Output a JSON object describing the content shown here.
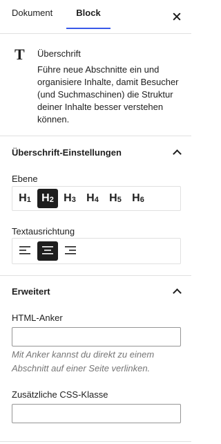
{
  "tabs": {
    "document": "Dokument",
    "block": "Block",
    "active": "Block"
  },
  "block": {
    "icon": "T",
    "icon_name": "heading-icon",
    "title": "Überschrift",
    "description": "Führe neue Abschnitte ein und organisiere Inhalte, damit Besucher (und Suchmaschinen) die Struktur deiner Inhalte besser verstehen können."
  },
  "heading_settings": {
    "title": "Überschrift-Einstellungen",
    "expanded": true,
    "level_label": "Ebene",
    "levels": [
      {
        "main": "H",
        "sub": "1"
      },
      {
        "main": "H",
        "sub": "2"
      },
      {
        "main": "H",
        "sub": "3"
      },
      {
        "main": "H",
        "sub": "4"
      },
      {
        "main": "H",
        "sub": "5"
      },
      {
        "main": "H",
        "sub": "6"
      }
    ],
    "selected_level": 2,
    "alignment_label": "Textausrichtung",
    "alignments": [
      "align-left-icon",
      "align-center-icon",
      "align-right-icon"
    ],
    "selected_alignment": "center"
  },
  "advanced": {
    "title": "Erweitert",
    "expanded": true,
    "anchor_label": "HTML-Anker",
    "anchor_value": "",
    "anchor_help": "Mit Anker kannst du direkt zu einem Abschnitt auf einer Seite verlinken.",
    "css_label": "Zusätzliche CSS-Klasse",
    "css_value": ""
  },
  "colors": {
    "accent": "#3858e9",
    "active": "#1e1e1e",
    "border": "#e0e0e0",
    "help_text": "#757575"
  }
}
